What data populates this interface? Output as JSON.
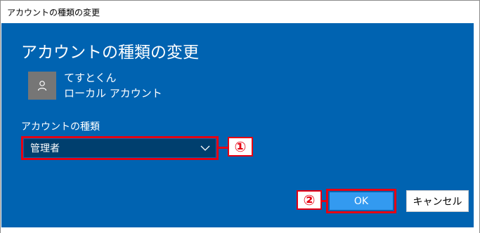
{
  "window": {
    "title": "アカウントの種類の変更"
  },
  "dialog": {
    "heading": "アカウントの種類の変更",
    "user": {
      "avatar_icon": "user-icon",
      "name": "てすとくん",
      "account_type": "ローカル アカウント"
    },
    "account_type_label": "アカウントの種類",
    "account_type_select": {
      "selected": "管理者",
      "arrow_icon": "chevron-down-icon"
    },
    "buttons": {
      "ok": "OK",
      "cancel": "キャンセル"
    }
  },
  "annotations": {
    "badge_1": "①",
    "badge_2": "②",
    "highlight_color": "#e60012"
  },
  "colors": {
    "dialog_background": "#0063b1",
    "select_background": "#003f6e",
    "ok_button": "#339af0"
  }
}
